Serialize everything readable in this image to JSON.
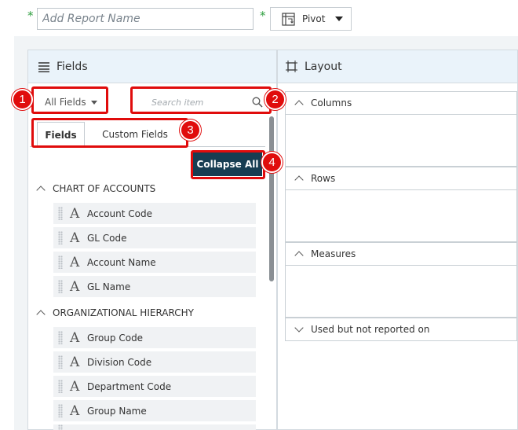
{
  "header": {
    "required_mark": "*",
    "report_name_placeholder": "Add Report Name",
    "report_type_label": "Pivot"
  },
  "fields_panel": {
    "title": "Fields",
    "filter_selected": "All Fields",
    "search_placeholder": "Search item",
    "tabs": [
      {
        "label": "Fields",
        "active": true
      },
      {
        "label": "Custom Fields",
        "active": false
      }
    ],
    "collapse_all_label": "Collapse All",
    "groups": [
      {
        "title": "CHART OF ACCOUNTS",
        "items": [
          "Account Code",
          "GL Code",
          "Account Name",
          "GL Name"
        ]
      },
      {
        "title": "ORGANIZATIONAL HIERARCHY",
        "items": [
          "Group Code",
          "Division Code",
          "Department Code",
          "Group Name"
        ]
      }
    ],
    "field_type_glyph": "A"
  },
  "layout_panel": {
    "title": "Layout",
    "sections": [
      {
        "label": "Columns",
        "expanded": true
      },
      {
        "label": "Rows",
        "expanded": true
      },
      {
        "label": "Measures",
        "expanded": true
      },
      {
        "label": "Used but not reported on",
        "expanded": false
      }
    ]
  },
  "callouts": [
    "1",
    "2",
    "3",
    "4"
  ],
  "colors": {
    "callout_red": "#e00c0c",
    "primary_button": "#173d52",
    "required_green": "#2e9e3f",
    "header_bg": "#eaf3fa"
  }
}
